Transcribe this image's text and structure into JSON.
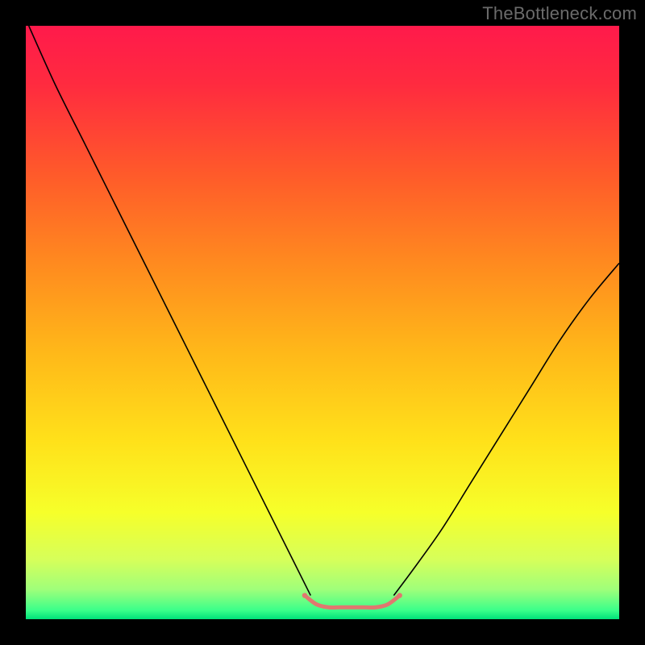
{
  "watermark": "TheBottleneck.com",
  "chart_data": {
    "type": "line",
    "title": "",
    "xlabel": "",
    "ylabel": "",
    "xlim": [
      0,
      100
    ],
    "ylim": [
      0,
      100
    ],
    "grid": false,
    "legend": false,
    "background_gradient_stops": [
      {
        "offset": 0.0,
        "color": "#ff1a4b"
      },
      {
        "offset": 0.1,
        "color": "#ff2b3f"
      },
      {
        "offset": 0.25,
        "color": "#ff5a2a"
      },
      {
        "offset": 0.4,
        "color": "#ff8a1f"
      },
      {
        "offset": 0.55,
        "color": "#ffb819"
      },
      {
        "offset": 0.7,
        "color": "#ffe11a"
      },
      {
        "offset": 0.82,
        "color": "#f6ff2a"
      },
      {
        "offset": 0.9,
        "color": "#d6ff5a"
      },
      {
        "offset": 0.95,
        "color": "#9fff7a"
      },
      {
        "offset": 0.985,
        "color": "#3bff8a"
      },
      {
        "offset": 1.0,
        "color": "#00e07a"
      }
    ],
    "series": [
      {
        "name": "left-curve",
        "color": "#000000",
        "width": 1.6,
        "x": [
          0.5,
          5,
          10,
          15,
          20,
          25,
          30,
          35,
          40,
          45,
          48
        ],
        "y": [
          100,
          90,
          80,
          70,
          60,
          50,
          40,
          30,
          20,
          10,
          4
        ]
      },
      {
        "name": "right-curve",
        "color": "#000000",
        "width": 1.6,
        "x": [
          62,
          65,
          70,
          75,
          80,
          85,
          90,
          95,
          100
        ],
        "y": [
          4,
          8,
          15,
          23,
          31,
          39,
          47,
          54,
          60
        ]
      },
      {
        "name": "valley-flat",
        "color": "#e0786f",
        "width": 5,
        "rounded": true,
        "x": [
          47,
          49,
          51,
          53,
          55,
          57,
          59,
          61,
          63
        ],
        "y": [
          4,
          2.5,
          2,
          2,
          2,
          2,
          2,
          2.5,
          4
        ]
      }
    ],
    "markers": [
      {
        "name": "valley-end-left",
        "x": 47,
        "y": 4,
        "r": 3.2,
        "color": "#e0786f"
      },
      {
        "name": "valley-end-right",
        "x": 63,
        "y": 4,
        "r": 3.2,
        "color": "#e0786f"
      }
    ]
  }
}
